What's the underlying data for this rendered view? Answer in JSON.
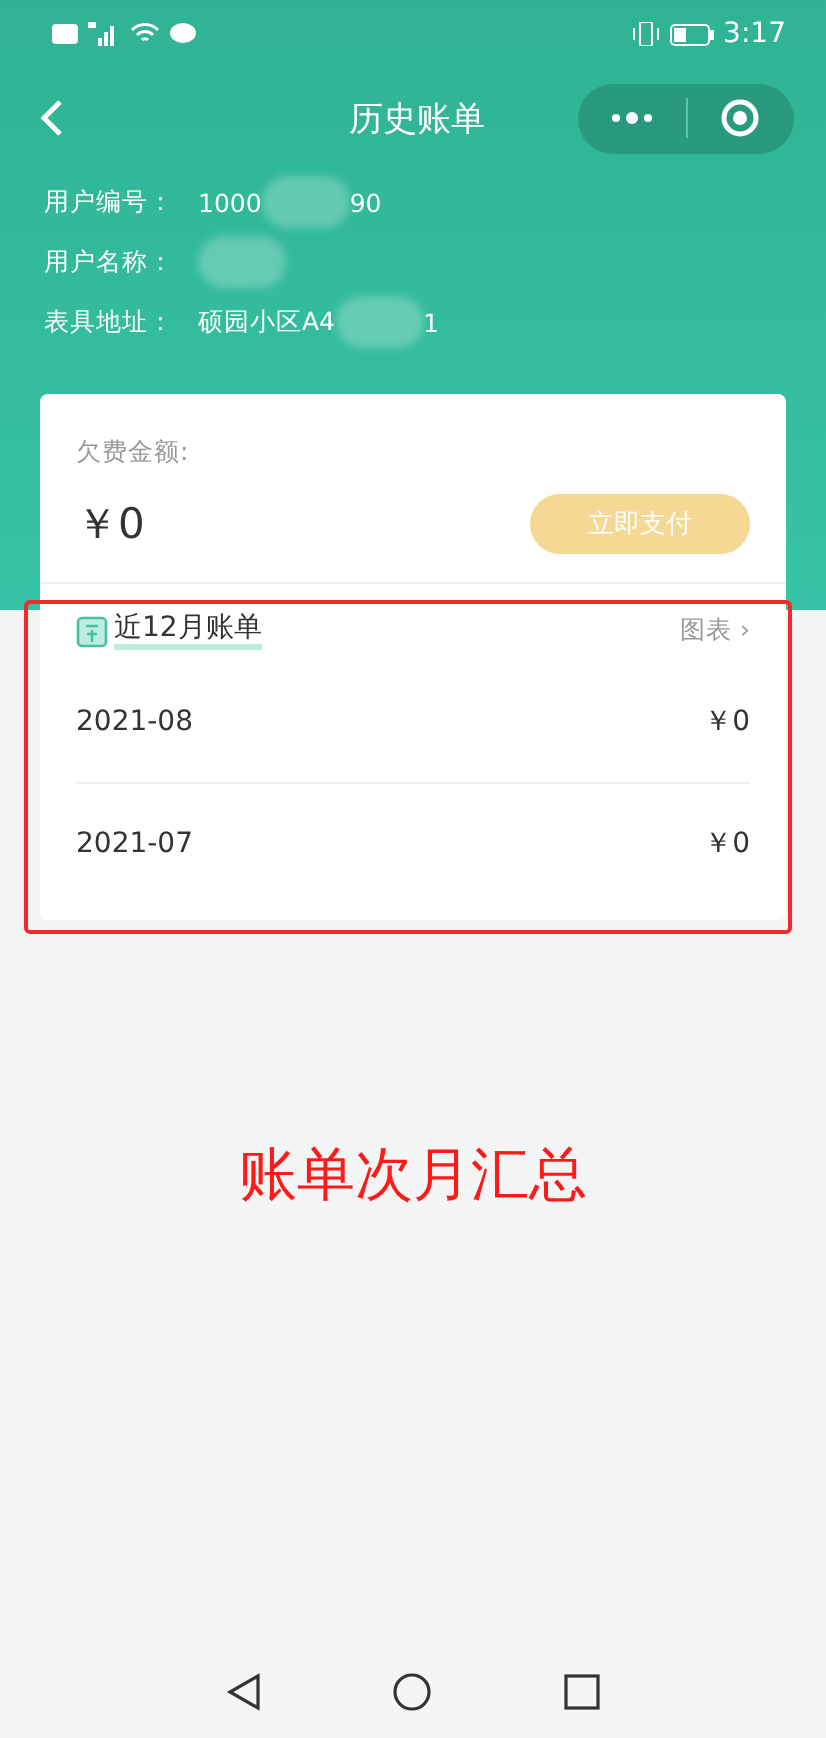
{
  "status_bar": {
    "time": "3:17"
  },
  "header": {
    "title": "历史账单"
  },
  "user_info": [
    {
      "label": "用户编号：",
      "parts": [
        "1000",
        "90"
      ]
    },
    {
      "label": "用户名称："
    },
    {
      "label": "表具地址：",
      "parts": [
        "硕园小区A4",
        "1"
      ]
    }
  ],
  "arrears": {
    "label": "欠费金额:",
    "amount": "￥0",
    "pay_button": {
      "label": "立即支付",
      "disabled": true
    }
  },
  "bills": {
    "title": "近12月账单",
    "chart_link": "图表",
    "chevron": "›",
    "rows": [
      {
        "month": "2021-08",
        "amount": "￥0"
      },
      {
        "month": "2021-07",
        "amount": "￥0"
      }
    ]
  },
  "annotation": {
    "text": "账单次月汇总"
  }
}
